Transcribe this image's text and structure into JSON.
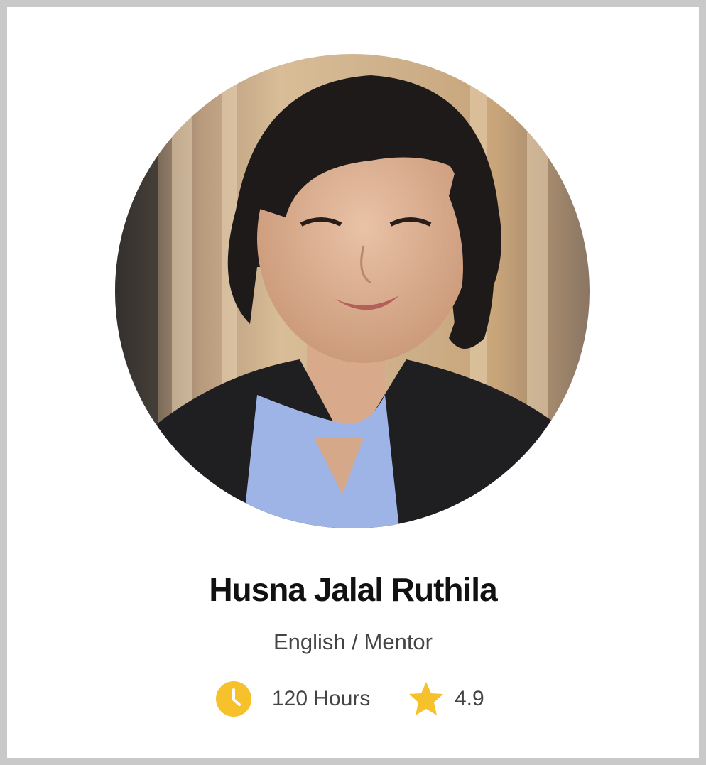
{
  "profile": {
    "name": "Husna Jalal Ruthila",
    "role": "English / Mentor",
    "hours": "120 Hours",
    "rating": "4.9",
    "avatar_description": "Portrait photo of mentor",
    "icons": {
      "hours": "clock-icon",
      "rating": "star-icon"
    }
  },
  "colors": {
    "accent": "#F6C12B",
    "name_text": "#111111",
    "secondary_text": "#444444",
    "card_background": "#FFFFFF",
    "frame": "#C9C9C9"
  }
}
